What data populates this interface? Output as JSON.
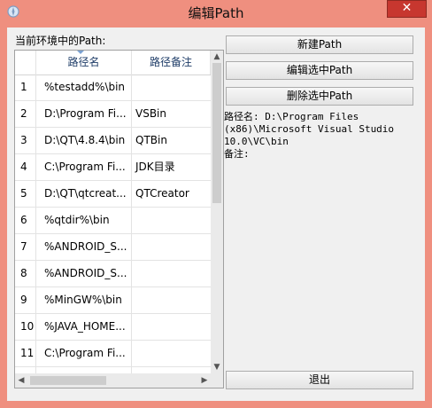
{
  "window": {
    "title": "编辑Path",
    "close_label": "✕"
  },
  "list_label": "当前环境中的Path:",
  "table": {
    "columns": [
      "路径名",
      "路径备注"
    ],
    "rows": [
      {
        "num": "1",
        "path": "%testadd%\\bin",
        "note": ""
      },
      {
        "num": "2",
        "path": "D:\\Program Fi...",
        "note": "VSBin"
      },
      {
        "num": "3",
        "path": "D:\\QT\\4.8.4\\bin",
        "note": "QTBin"
      },
      {
        "num": "4",
        "path": "C:\\Program Fi...",
        "note": "JDK目录"
      },
      {
        "num": "5",
        "path": "D:\\QT\\qtcreat...",
        "note": "QTCreator"
      },
      {
        "num": "6",
        "path": "%qtdir%\\bin",
        "note": ""
      },
      {
        "num": "7",
        "path": "%ANDROID_S...",
        "note": ""
      },
      {
        "num": "8",
        "path": "%ANDROID_S...",
        "note": ""
      },
      {
        "num": "9",
        "path": "%MinGW%\\bin",
        "note": ""
      },
      {
        "num": "10",
        "path": "%JAVA_HOME...",
        "note": ""
      },
      {
        "num": "11",
        "path": "C:\\Program Fi...",
        "note": ""
      },
      {
        "num": "",
        "path": "",
        "note": ""
      }
    ]
  },
  "buttons": {
    "new_label": "新建Path",
    "edit_label": "编辑选中Path",
    "delete_label": "删除选中Path",
    "exit_label": "退出"
  },
  "info": {
    "line1": "路径名: D:\\Program Files",
    "line2": "(x86)\\Microsoft Visual Studio",
    "line3": "10.0\\VC\\bin",
    "line4": "备注:"
  },
  "colors": {
    "frame": "#ef8f7f",
    "close": "#c7372f",
    "client": "#f0f0f0"
  }
}
